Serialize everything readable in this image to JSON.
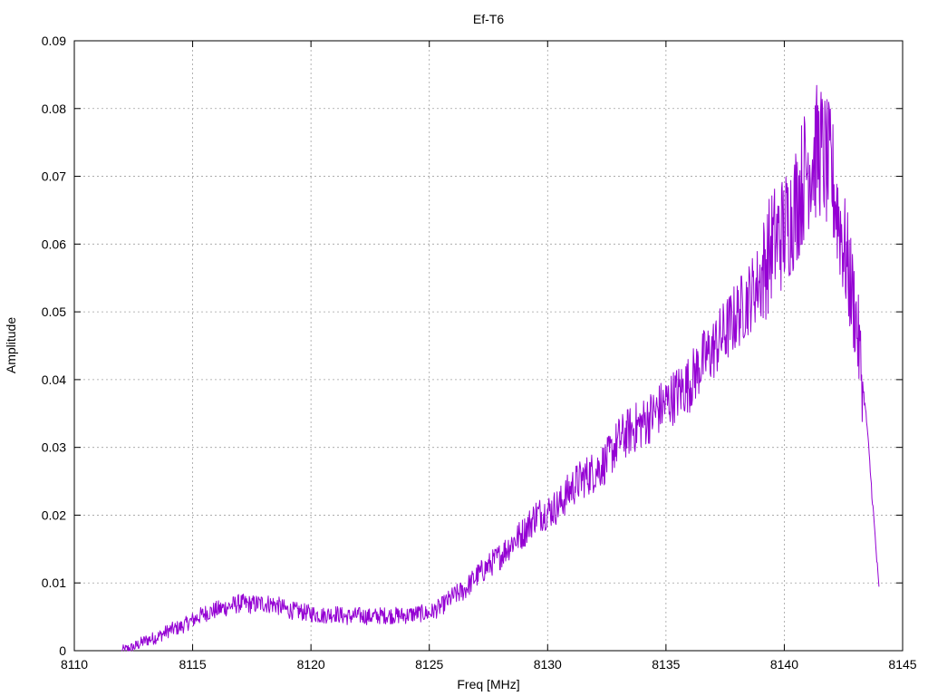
{
  "chart_data": {
    "type": "line",
    "title": "Ef-T6",
    "xlabel": "Freq [MHz]",
    "ylabel": "Amplitude",
    "xlim": [
      8110,
      8145
    ],
    "ylim": [
      0,
      0.09
    ],
    "x_ticks": [
      8110,
      8115,
      8120,
      8125,
      8130,
      8135,
      8140,
      8145
    ],
    "x_tick_labels": [
      "8110",
      "8115",
      "8120",
      "8125",
      "8130",
      "8135",
      "8140",
      "8145"
    ],
    "y_ticks": [
      0,
      0.01,
      0.02,
      0.03,
      0.04,
      0.05,
      0.06,
      0.07,
      0.08,
      0.09
    ],
    "y_tick_labels": [
      "0",
      "0.01",
      "0.02",
      "0.03",
      "0.04",
      "0.05",
      "0.06",
      "0.07",
      "0.08",
      "0.09"
    ],
    "grid": true,
    "series": [
      {
        "color": "#9400d3",
        "x": [
          8112.0,
          8112.5,
          8113.0,
          8113.5,
          8114.0,
          8114.5,
          8115.0,
          8115.5,
          8116.0,
          8116.5,
          8117.0,
          8117.5,
          8118.0,
          8118.5,
          8119.0,
          8119.5,
          8120.0,
          8120.5,
          8121.0,
          8121.5,
          8122.0,
          8122.5,
          8123.0,
          8123.5,
          8124.0,
          8124.5,
          8125.0,
          8125.5,
          8126.0,
          8126.5,
          8127.0,
          8127.5,
          8128.0,
          8128.5,
          8129.0,
          8129.5,
          8130.0,
          8130.5,
          8131.0,
          8131.5,
          8132.0,
          8132.5,
          8133.0,
          8133.5,
          8134.0,
          8134.5,
          8135.0,
          8135.5,
          8136.0,
          8136.5,
          8137.0,
          8137.5,
          8138.0,
          8138.5,
          8139.0,
          8139.5,
          8140.0,
          8140.5,
          8141.0,
          8141.5,
          8142.0,
          8142.5,
          8143.0,
          8143.5,
          8144.0
        ],
        "y": [
          0.0,
          0.0005,
          0.0015,
          0.002,
          0.003,
          0.0035,
          0.0045,
          0.0055,
          0.006,
          0.0065,
          0.007,
          0.0068,
          0.007,
          0.0068,
          0.006,
          0.0058,
          0.0055,
          0.0052,
          0.0055,
          0.005,
          0.0052,
          0.005,
          0.0052,
          0.0052,
          0.0052,
          0.0055,
          0.0055,
          0.0065,
          0.008,
          0.009,
          0.011,
          0.0125,
          0.014,
          0.016,
          0.0175,
          0.02,
          0.0205,
          0.0215,
          0.024,
          0.0255,
          0.0265,
          0.028,
          0.031,
          0.0325,
          0.0335,
          0.035,
          0.0365,
          0.038,
          0.0395,
          0.0425,
          0.0445,
          0.047,
          0.0495,
          0.052,
          0.055,
          0.06,
          0.062,
          0.066,
          0.072,
          0.074,
          0.07,
          0.06,
          0.05,
          0.033,
          0.009
        ]
      }
    ]
  }
}
